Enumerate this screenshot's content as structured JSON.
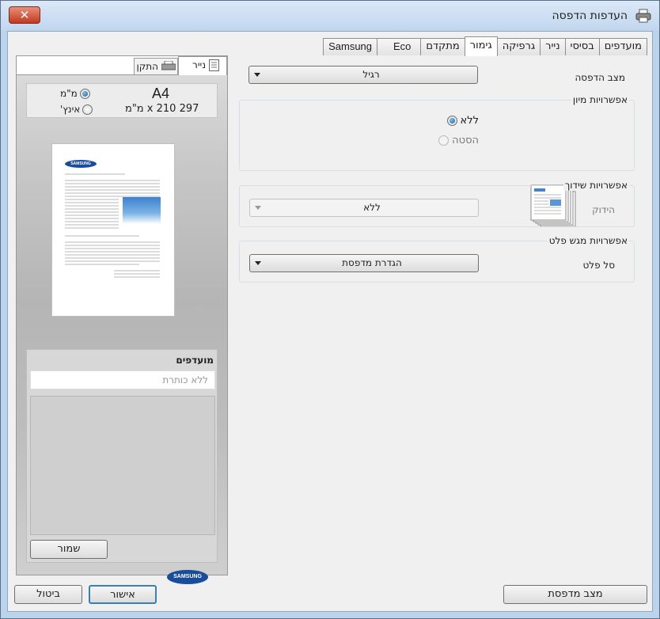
{
  "window": {
    "title": "העדפות הדפסה",
    "close_label": "✕"
  },
  "tabs": [
    {
      "label": "מועדפים"
    },
    {
      "label": "בסיסי"
    },
    {
      "label": "נייר"
    },
    {
      "label": "גרפיקה"
    },
    {
      "label": "גימור"
    },
    {
      "label": "מתקדם"
    },
    {
      "label": "Eco"
    },
    {
      "label": "Samsung"
    }
  ],
  "active_tab": "גימור",
  "left_panel": {
    "tab_paper": "נייר",
    "tab_device": "התקן",
    "paper_size": "A4",
    "paper_dims": "297 x 210 מ\"מ",
    "units": [
      {
        "label": "מ\"מ",
        "selected": true
      },
      {
        "label": "אינץ'",
        "selected": false
      }
    ],
    "favorites_label": "מועדפים",
    "favorites_placeholder": "ללא כותרת",
    "save_button": "שמור",
    "brand": "SAMSUNG"
  },
  "finishing": {
    "print_mode_label": "מצב הדפסה",
    "print_mode_value": "רגיל",
    "sort_group_title": "אפשרויות מיון",
    "sort_options": [
      {
        "label": "ללא",
        "selected": true
      },
      {
        "label": "הסטה",
        "selected": false,
        "disabled": true
      }
    ],
    "binding_group_title": "אפשרויות שידוך",
    "binding_label": "הידוק",
    "binding_value": "ללא",
    "output_group_title": "אפשרויות מגש פלט",
    "output_tray_label": "סל פלט",
    "output_tray_value": "הגדרת מדפסת"
  },
  "footer": {
    "printer_status": "מצב מדפסת",
    "ok": "אישור",
    "cancel": "ביטול"
  }
}
